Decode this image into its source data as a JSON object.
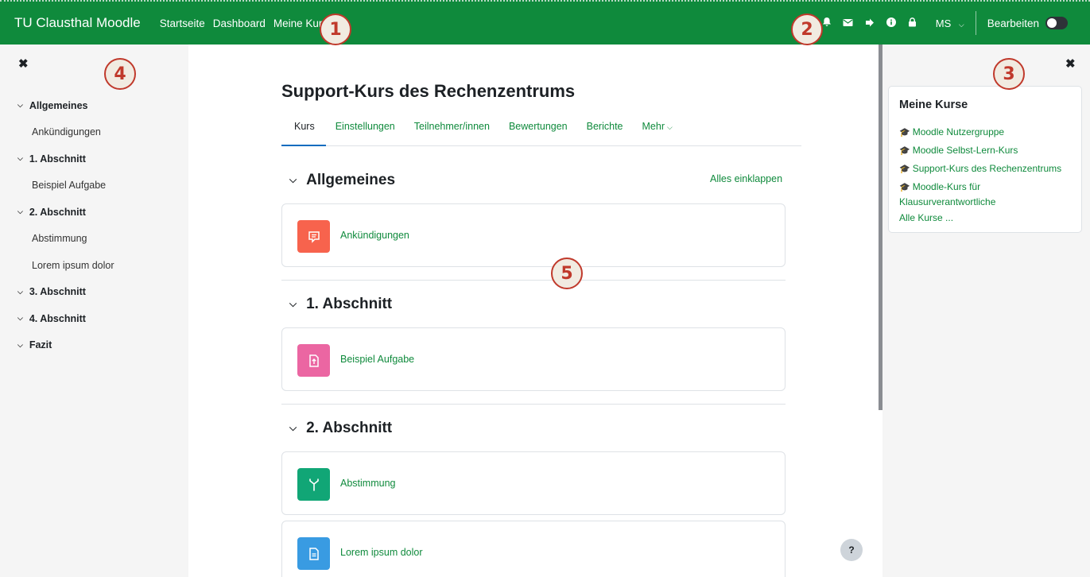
{
  "navbar": {
    "brand": "TU Clausthal Moodle",
    "links": [
      "Startseite",
      "Dashboard",
      "Meine Kurse"
    ],
    "user_initials": "MS",
    "edit_label": "Bearbeiten",
    "edit_mode_on": false,
    "background": "#0f8a3c"
  },
  "markers": [
    "1",
    "2",
    "3",
    "4",
    "5"
  ],
  "course_index": {
    "close_glyph": "✖",
    "entries": [
      {
        "type": "section",
        "label": "Allgemeines"
      },
      {
        "type": "item",
        "label": "Ankündigungen"
      },
      {
        "type": "section",
        "label": "1. Abschnitt"
      },
      {
        "type": "item",
        "label": "Beispiel Aufgabe"
      },
      {
        "type": "section",
        "label": "2. Abschnitt"
      },
      {
        "type": "item",
        "label": "Abstimmung"
      },
      {
        "type": "item",
        "label": "Lorem ipsum dolor"
      },
      {
        "type": "section",
        "label": "3. Abschnitt"
      },
      {
        "type": "section",
        "label": "4. Abschnitt"
      },
      {
        "type": "section",
        "label": "Fazit"
      }
    ]
  },
  "course": {
    "title": "Support-Kurs des Rechenzentrums",
    "tabs": [
      "Kurs",
      "Einstellungen",
      "Teilnehmer/innen",
      "Bewertungen",
      "Berichte",
      "Mehr"
    ],
    "active_tab": "Kurs",
    "collapse_all": "Alles einklappen",
    "sections": [
      {
        "title": "Allgemeines",
        "activities": [
          {
            "name": "Ankündigungen",
            "icon": "forum-icon",
            "color": "#f7634d"
          }
        ]
      },
      {
        "title": "1. Abschnitt",
        "activities": [
          {
            "name": "Beispiel Aufgabe",
            "icon": "assignment-icon",
            "color": "#eb66a2"
          }
        ]
      },
      {
        "title": "2. Abschnitt",
        "activities": [
          {
            "name": "Abstimmung",
            "icon": "choice-icon",
            "color": "#11a676"
          },
          {
            "name": "Lorem ipsum dolor",
            "icon": "page-icon",
            "color": "#399be2"
          }
        ]
      }
    ],
    "help_glyph": "?"
  },
  "block_my_courses": {
    "title": "Meine Kurse",
    "close_glyph": "✖",
    "courses": [
      "Moodle Nutzergruppe",
      "Moodle Selbst-Lern-Kurs",
      "Support-Kurs des Rechenzentrums",
      "Moodle-Kurs für Klausurverantwortliche"
    ],
    "all_courses": "Alle Kurse ..."
  }
}
